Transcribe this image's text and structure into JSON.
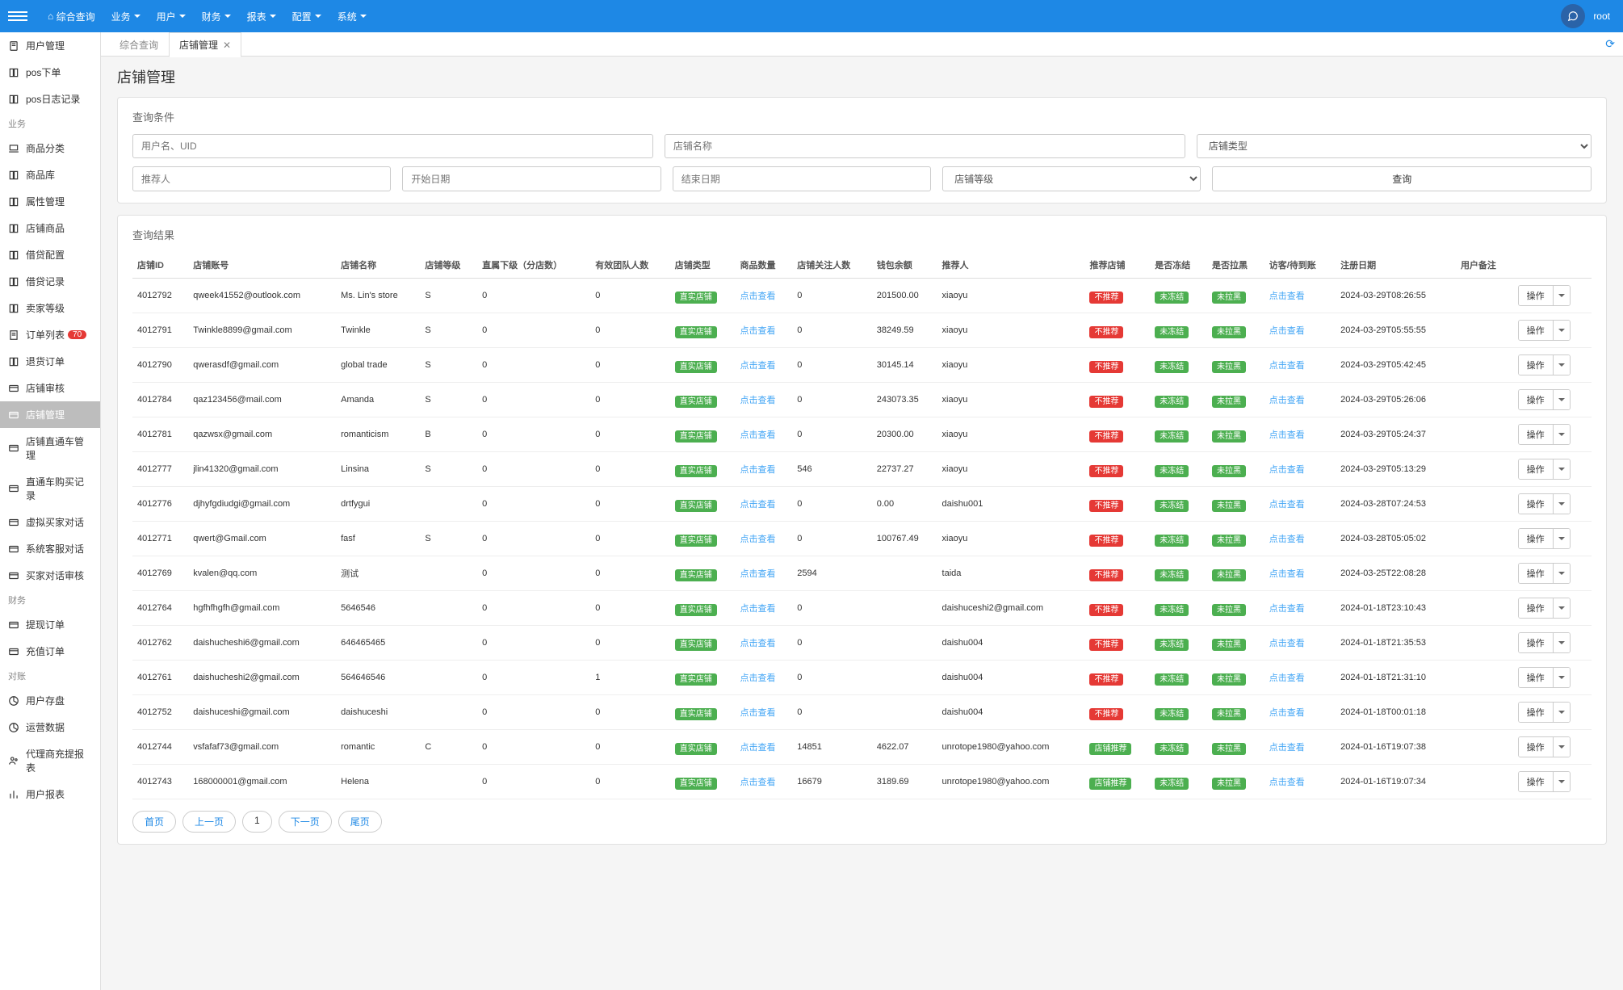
{
  "topbar": {
    "menu": [
      {
        "label": "综合查询",
        "hasHome": true
      },
      {
        "label": "业务"
      },
      {
        "label": "用户"
      },
      {
        "label": "财务"
      },
      {
        "label": "报表"
      },
      {
        "label": "配置"
      },
      {
        "label": "系统"
      }
    ],
    "user": "root"
  },
  "sidebar": [
    {
      "type": "item",
      "label": "用户管理",
      "icon": "file"
    },
    {
      "type": "item",
      "label": "pos下单",
      "icon": "book"
    },
    {
      "type": "item",
      "label": "pos日志记录",
      "icon": "book"
    },
    {
      "type": "section",
      "label": "业务"
    },
    {
      "type": "item",
      "label": "商品分类",
      "icon": "laptop"
    },
    {
      "type": "item",
      "label": "商品库",
      "icon": "book"
    },
    {
      "type": "item",
      "label": "属性管理",
      "icon": "book"
    },
    {
      "type": "item",
      "label": "店铺商品",
      "icon": "book"
    },
    {
      "type": "item",
      "label": "借贷配置",
      "icon": "book"
    },
    {
      "type": "item",
      "label": "借贷记录",
      "icon": "book"
    },
    {
      "type": "item",
      "label": "卖家等级",
      "icon": "book"
    },
    {
      "type": "item",
      "label": "订单列表",
      "icon": "receipt",
      "badge": "70"
    },
    {
      "type": "item",
      "label": "退货订单",
      "icon": "book"
    },
    {
      "type": "item",
      "label": "店铺审核",
      "icon": "card"
    },
    {
      "type": "item",
      "label": "店铺管理",
      "icon": "card",
      "active": true
    },
    {
      "type": "item",
      "label": "店铺直通车管理",
      "icon": "card"
    },
    {
      "type": "item",
      "label": "直通车购买记录",
      "icon": "card"
    },
    {
      "type": "item",
      "label": "虚拟买家对话",
      "icon": "card"
    },
    {
      "type": "item",
      "label": "系统客服对话",
      "icon": "card"
    },
    {
      "type": "item",
      "label": "买家对话审核",
      "icon": "card"
    },
    {
      "type": "section",
      "label": "财务"
    },
    {
      "type": "item",
      "label": "提现订单",
      "icon": "card"
    },
    {
      "type": "item",
      "label": "充值订单",
      "icon": "card"
    },
    {
      "type": "section",
      "label": "对账"
    },
    {
      "type": "item",
      "label": "用户存盘",
      "icon": "pie"
    },
    {
      "type": "item",
      "label": "运营数据",
      "icon": "pie"
    },
    {
      "type": "item",
      "label": "代理商充提报表",
      "icon": "users"
    },
    {
      "type": "item",
      "label": "用户报表",
      "icon": "bars"
    }
  ],
  "tabs": {
    "items": [
      {
        "label": "综合查询",
        "closable": false
      },
      {
        "label": "店铺管理",
        "closable": true,
        "active": true
      }
    ]
  },
  "page": {
    "title": "店铺管理",
    "filter_title": "查询条件",
    "filters": {
      "user_uid_ph": "用户名、UID",
      "shop_name_ph": "店铺名称",
      "shop_type_ph": "店铺类型",
      "referrer_ph": "推荐人",
      "start_date_ph": "开始日期",
      "end_date_ph": "结束日期",
      "shop_level_ph": "店铺等级",
      "query_btn": "查询"
    },
    "result_title": "查询结果",
    "columns": [
      "店铺ID",
      "店铺账号",
      "店铺名称",
      "店铺等级",
      "直属下级（分店数）",
      "有效团队人数",
      "店铺类型",
      "商品数量",
      "店铺关注人数",
      "钱包余额",
      "推荐人",
      "推荐店铺",
      "是否冻结",
      "是否拉黑",
      "访客/待到账",
      "注册日期",
      "用户备注",
      ""
    ],
    "type_badge": "直实店铺",
    "click_view": "点击查看",
    "rec_no": "不推荐",
    "rec_yes": "店铺推荐",
    "freeze_no": "未冻结",
    "black_no": "未拉黑",
    "op_label": "操作",
    "rows": [
      {
        "id": "4012792",
        "acct": "qweek41552@outlook.com",
        "name": "Ms. Lin's store",
        "lvl": "S",
        "sub": "0",
        "team": "0",
        "qty": "",
        "fans": "0",
        "wallet": "201500.00",
        "ref": "xiaoyu",
        "rec": "no",
        "date": "2024-03-29T08:26:55"
      },
      {
        "id": "4012791",
        "acct": "Twinkle8899@gmail.com",
        "name": "Twinkle",
        "lvl": "S",
        "sub": "0",
        "team": "0",
        "qty": "",
        "fans": "0",
        "wallet": "38249.59",
        "ref": "xiaoyu",
        "rec": "no",
        "date": "2024-03-29T05:55:55"
      },
      {
        "id": "4012790",
        "acct": "qwerasdf@gmail.com",
        "name": "global trade",
        "lvl": "S",
        "sub": "0",
        "team": "0",
        "qty": "",
        "fans": "0",
        "wallet": "30145.14",
        "ref": "xiaoyu",
        "rec": "no",
        "date": "2024-03-29T05:42:45"
      },
      {
        "id": "4012784",
        "acct": "qaz123456@mail.com",
        "name": "Amanda",
        "lvl": "S",
        "sub": "0",
        "team": "0",
        "qty": "",
        "fans": "0",
        "wallet": "243073.35",
        "ref": "xiaoyu",
        "rec": "no",
        "date": "2024-03-29T05:26:06"
      },
      {
        "id": "4012781",
        "acct": "qazwsx@gmail.com",
        "name": "romanticism",
        "lvl": "B",
        "sub": "0",
        "team": "0",
        "qty": "",
        "fans": "0",
        "wallet": "20300.00",
        "ref": "xiaoyu",
        "rec": "no",
        "date": "2024-03-29T05:24:37"
      },
      {
        "id": "4012777",
        "acct": "jlin41320@gmail.com",
        "name": "Linsina",
        "lvl": "S",
        "sub": "0",
        "team": "0",
        "qty": "",
        "fans": "546",
        "wallet": "22737.27",
        "ref": "xiaoyu",
        "rec": "no",
        "date": "2024-03-29T05:13:29"
      },
      {
        "id": "4012776",
        "acct": "djhyfgdiudgi@gmail.com",
        "name": "drtfygui",
        "lvl": "",
        "sub": "0",
        "team": "0",
        "qty": "",
        "fans": "0",
        "wallet": "0.00",
        "ref": "daishu001",
        "rec": "no",
        "date": "2024-03-28T07:24:53"
      },
      {
        "id": "4012771",
        "acct": "qwert@Gmail.com",
        "name": "fasf",
        "lvl": "S",
        "sub": "0",
        "team": "0",
        "qty": "",
        "fans": "0",
        "wallet": "100767.49",
        "ref": "xiaoyu",
        "rec": "no",
        "date": "2024-03-28T05:05:02"
      },
      {
        "id": "4012769",
        "acct": "kvalen@qq.com",
        "name": "测试",
        "lvl": "",
        "sub": "0",
        "team": "0",
        "qty": "",
        "fans": "2594",
        "wallet": "",
        "ref": "taida",
        "rec": "no",
        "date": "2024-03-25T22:08:28"
      },
      {
        "id": "4012764",
        "acct": "hgfhfhgfh@gmail.com",
        "name": "5646546",
        "lvl": "",
        "sub": "0",
        "team": "0",
        "qty": "",
        "fans": "0",
        "wallet": "",
        "ref": "daishuceshi2@gmail.com",
        "rec": "no",
        "date": "2024-01-18T23:10:43"
      },
      {
        "id": "4012762",
        "acct": "daishucheshi6@gmail.com",
        "name": "646465465",
        "lvl": "",
        "sub": "0",
        "team": "0",
        "qty": "",
        "fans": "0",
        "wallet": "",
        "ref": "daishu004",
        "rec": "no",
        "date": "2024-01-18T21:35:53"
      },
      {
        "id": "4012761",
        "acct": "daishucheshi2@gmail.com",
        "name": "564646546",
        "lvl": "",
        "sub": "0",
        "team": "1",
        "qty": "",
        "fans": "0",
        "wallet": "",
        "ref": "daishu004",
        "rec": "no",
        "date": "2024-01-18T21:31:10"
      },
      {
        "id": "4012752",
        "acct": "daishuceshi@gmail.com",
        "name": "daishuceshi",
        "lvl": "",
        "sub": "0",
        "team": "0",
        "qty": "",
        "fans": "0",
        "wallet": "",
        "ref": "daishu004",
        "rec": "no",
        "date": "2024-01-18T00:01:18"
      },
      {
        "id": "4012744",
        "acct": "vsfafaf73@gmail.com",
        "name": "romantic",
        "lvl": "C",
        "sub": "0",
        "team": "0",
        "qty": "",
        "fans": "14851",
        "wallet": "4622.07",
        "ref": "unrotope1980@yahoo.com",
        "rec": "yes",
        "date": "2024-01-16T19:07:38"
      },
      {
        "id": "4012743",
        "acct": "168000001@gmail.com",
        "name": "Helena",
        "lvl": "",
        "sub": "0",
        "team": "0",
        "qty": "",
        "fans": "16679",
        "wallet": "3189.69",
        "ref": "unrotope1980@yahoo.com",
        "rec": "yes",
        "date": "2024-01-16T19:07:34"
      }
    ],
    "pagination": {
      "first": "首页",
      "prev": "上一页",
      "page": "1",
      "next": "下一页",
      "last": "尾页"
    }
  }
}
